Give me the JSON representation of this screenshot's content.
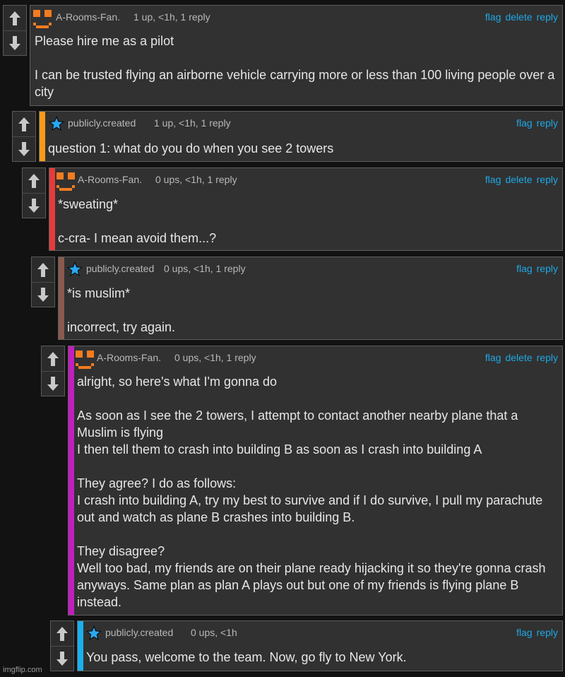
{
  "comments": [
    {
      "username": "A-Rooms-Fan.",
      "meta": "1 up, <1h, 1 reply",
      "actions": [
        "flag",
        "delete",
        "reply"
      ],
      "body": "Please hire me as a pilot\n\nI can be trusted flying an airborne vehicle carrying more or less than 100 living people over a city",
      "avatar": "orange-face-avatar",
      "bar_color": ""
    },
    {
      "username": "publicly.created",
      "meta": "1 up, <1h, 1 reply",
      "actions": [
        "flag",
        "reply"
      ],
      "body": "question 1: what do you do when you see 2 towers",
      "avatar": "blue-star-icon",
      "bar_color": "#f59a1c"
    },
    {
      "username": "A-Rooms-Fan.",
      "meta": "0 ups, <1h, 1 reply",
      "actions": [
        "flag",
        "delete",
        "reply"
      ],
      "body": "*sweating*\n\nc-cra- I mean avoid them...?",
      "avatar": "orange-face-avatar",
      "bar_color": "#e53b3b"
    },
    {
      "username": "publicly.created",
      "meta": "0 ups, <1h, 1 reply",
      "actions": [
        "flag",
        "reply"
      ],
      "body": "*is muslim*\n\nincorrect, try again.",
      "avatar": "blue-star-icon",
      "bar_color": "#8a5a4f"
    },
    {
      "username": "A-Rooms-Fan.",
      "meta": "0 ups, <1h, 1 reply",
      "actions": [
        "flag",
        "delete",
        "reply"
      ],
      "body": "alright, so here's what I'm gonna do\n\nAs soon as I see the 2 towers, I attempt to contact another nearby plane that a Muslim is flying\nI then tell them to crash into building B as soon as I crash into building A\n\nThey agree? I do as follows:\nI crash into building A, try my best to survive and if I do survive, I pull my parachute out and watch as plane B crashes into building B.\n\nThey disagree?\nWell too bad, my friends are on their plane ready hijacking it so they're gonna crash anyways. Same plan as plan A plays out but one of my friends is flying plane B instead.",
      "avatar": "orange-face-avatar",
      "bar_color": "#c21fbf"
    },
    {
      "username": "publicly.created",
      "meta": "0 ups, <1h",
      "actions": [
        "flag",
        "reply"
      ],
      "body": "You pass, welcome to the team. Now, go fly to New York.",
      "avatar": "blue-star-icon",
      "bar_color": "#1cb0ec"
    }
  ],
  "watermark": "imgflip.com"
}
